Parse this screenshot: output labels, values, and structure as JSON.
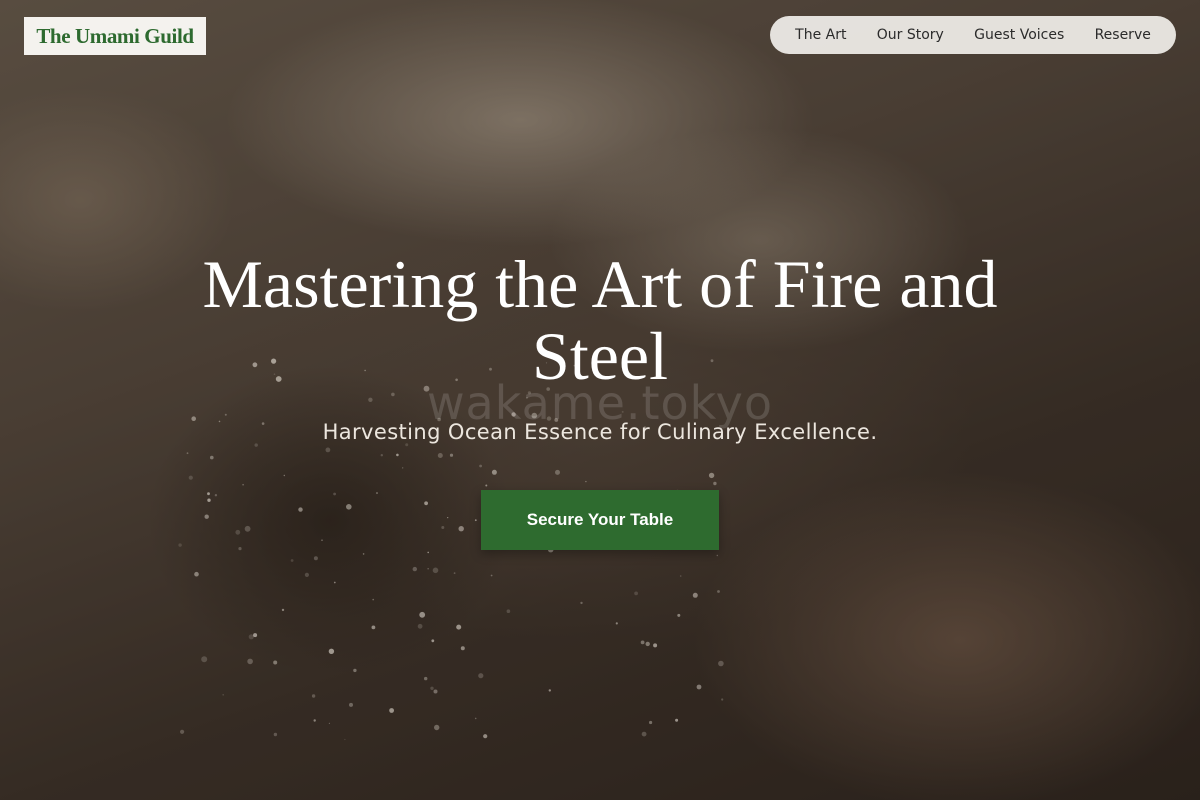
{
  "header": {
    "logo_text": "The Umami Guild",
    "nav": [
      {
        "label": "The Art"
      },
      {
        "label": "Our Story"
      },
      {
        "label": "Guest Voices"
      },
      {
        "label": "Reserve"
      }
    ]
  },
  "hero": {
    "title": "Mastering the Art of Fire and Steel",
    "watermark": "wakame.tokyo",
    "subtitle": "Harvesting Ocean Essence for Culinary Excellence.",
    "cta_label": "Secure Your Table"
  },
  "colors": {
    "brand_green": "#2e6b2f",
    "logo_text": "#2d6a2f",
    "nav_background": "#f0eeea"
  }
}
